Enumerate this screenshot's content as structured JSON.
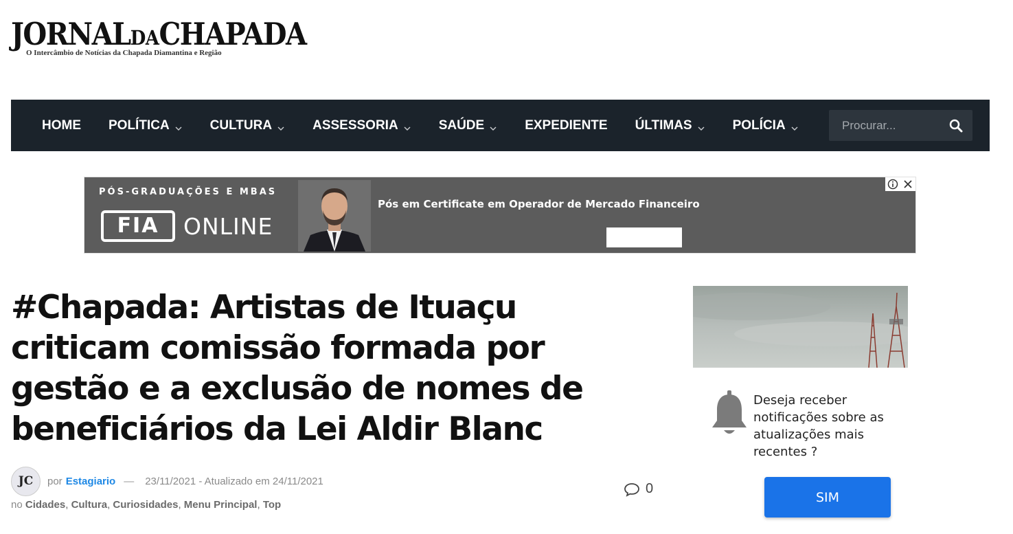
{
  "logo": {
    "name_part1": "JORNAL",
    "name_part2": "DA",
    "name_part3": "CHAPADA",
    "tagline": "O Intercâmbio de Notícias da Chapada Diamantina e Região"
  },
  "nav": {
    "items": [
      {
        "label": "HOME",
        "has_dropdown": false
      },
      {
        "label": "POLÍTICA",
        "has_dropdown": true
      },
      {
        "label": "CULTURA",
        "has_dropdown": true
      },
      {
        "label": "ASSESSORIA",
        "has_dropdown": true
      },
      {
        "label": "SAÚDE",
        "has_dropdown": true
      },
      {
        "label": "EXPEDIENTE",
        "has_dropdown": false
      },
      {
        "label": "ÚLTIMAS",
        "has_dropdown": true
      },
      {
        "label": "POLÍCIA",
        "has_dropdown": true
      }
    ],
    "search_placeholder": "Procurar...",
    "search_icon": "search-icon",
    "bg_color": "#1b232b"
  },
  "ad": {
    "top_text": "PÓS-GRADUAÇÕES E MBAS",
    "brand_box": "FIA",
    "brand_text": "ONLINE",
    "headline": "Pós em Certificate em Operador de Mercado Financeiro",
    "info_icon": "info-icon",
    "close_icon": "close-icon"
  },
  "article": {
    "title": "#Chapada: Artistas de Ituaçu criticam comissão formada por gestão e a exclusão de nomes de beneficiários da Lei Aldir Blanc",
    "avatar_text": "JC",
    "by_label": "por",
    "author": "Estagiario",
    "dash": "—",
    "date": "23/11/2021 - Atualizado em 24/11/2021",
    "categories_prefix": "no",
    "categories": [
      "Cidades",
      "Cultura",
      "Curiosidades",
      "Menu Principal",
      "Top"
    ],
    "comment_count": "0"
  },
  "notification": {
    "text": "Deseja receber notificações sobre as atualizações mais recentes ?",
    "button": "SIM",
    "button_color": "#1a73e8"
  }
}
